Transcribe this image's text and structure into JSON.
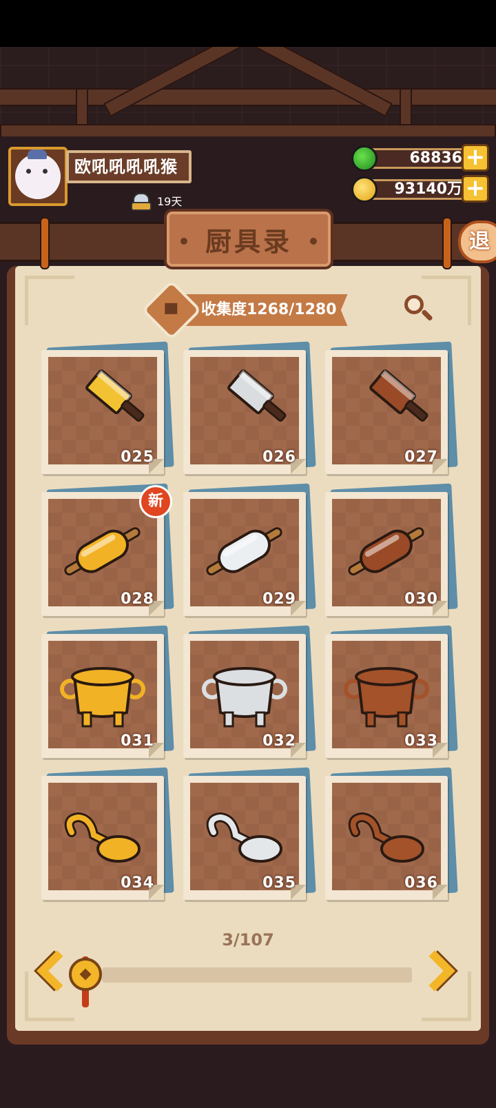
{
  "player": {
    "name": "欧吼吼吼吼猴",
    "days": "19天"
  },
  "resources": {
    "jade": "68836",
    "coins": "93140万",
    "plus_label": "+"
  },
  "title": "厨具录",
  "exit_label": "退",
  "collection": {
    "label": "收集度1268/1280"
  },
  "items": [
    {
      "id": "025",
      "kind": "cleaver",
      "color": "#f2c233",
      "is_new": false
    },
    {
      "id": "026",
      "kind": "cleaver",
      "color": "#d9dde0",
      "is_new": false
    },
    {
      "id": "027",
      "kind": "cleaver",
      "color": "#9a4a26",
      "is_new": false
    },
    {
      "id": "028",
      "kind": "rolling-pin",
      "color": "#f2b226",
      "is_new": true
    },
    {
      "id": "029",
      "kind": "rolling-pin",
      "color": "#eceff1",
      "is_new": false
    },
    {
      "id": "030",
      "kind": "rolling-pin",
      "color": "#9a4a26",
      "is_new": false
    },
    {
      "id": "031",
      "kind": "cauldron",
      "color": "#f2b226",
      "is_new": false
    },
    {
      "id": "032",
      "kind": "cauldron",
      "color": "#dcdfe2",
      "is_new": false
    },
    {
      "id": "033",
      "kind": "cauldron",
      "color": "#a4522a",
      "is_new": false
    },
    {
      "id": "034",
      "kind": "ladle",
      "color": "#f2b226",
      "is_new": false
    },
    {
      "id": "035",
      "kind": "ladle",
      "color": "#e4e7ea",
      "is_new": false
    },
    {
      "id": "036",
      "kind": "ladle",
      "color": "#a4522a",
      "is_new": false
    }
  ],
  "new_badge": "新",
  "pagination": {
    "indicator": "3/107",
    "current": 3,
    "total": 107
  }
}
